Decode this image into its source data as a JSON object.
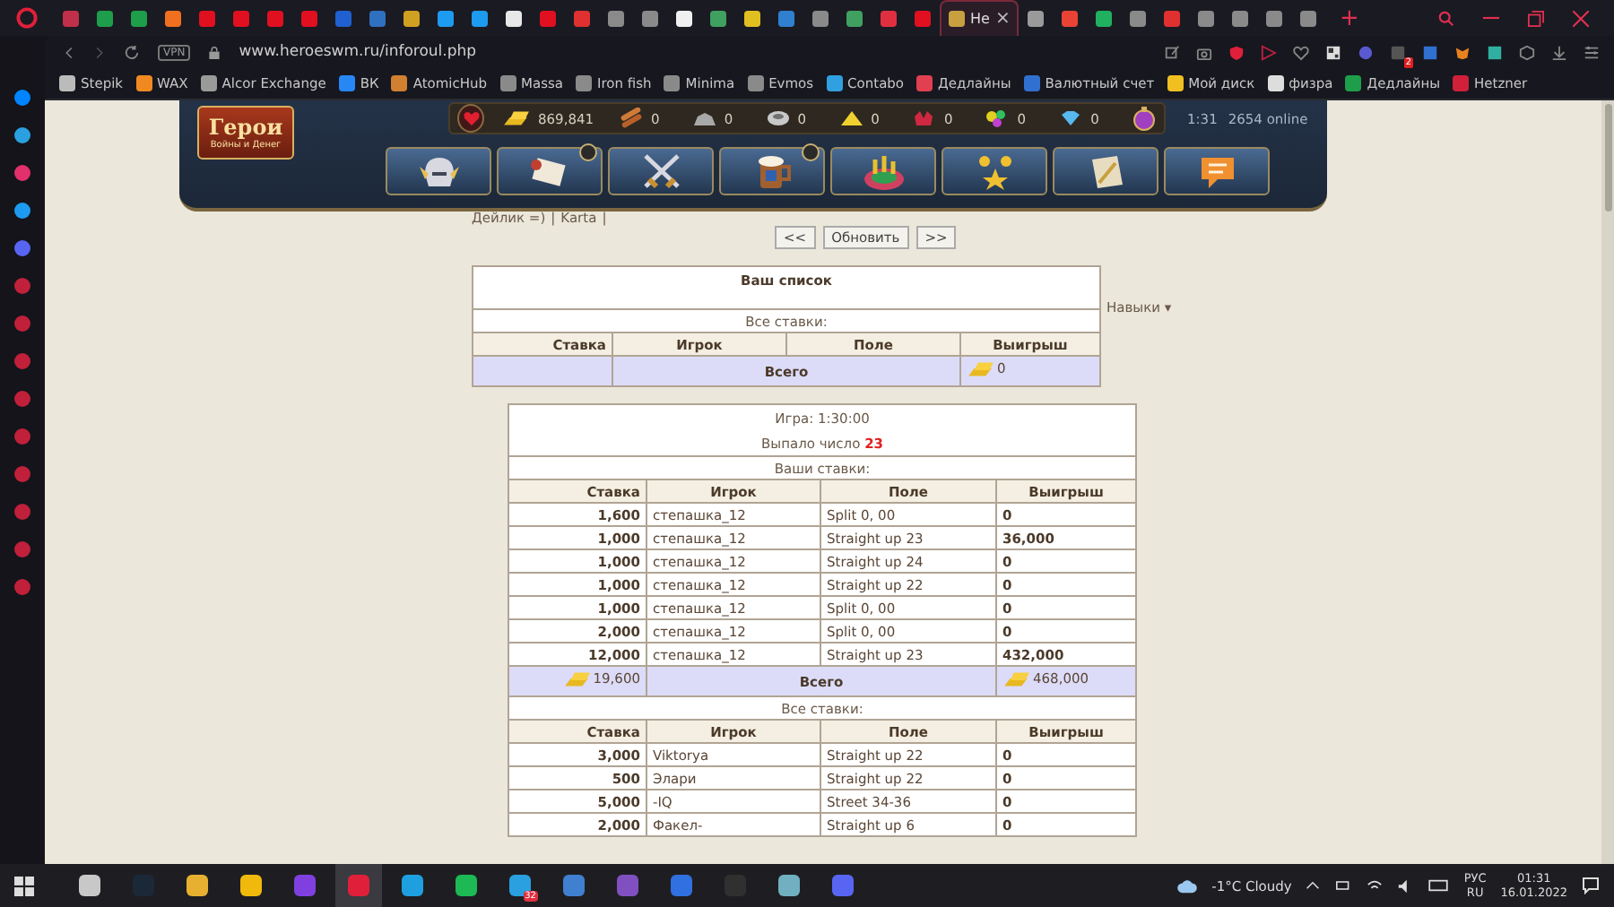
{
  "browser": {
    "tabs": [
      {
        "color": "#c0304a",
        "selected": false
      },
      {
        "color": "#1e9e4a",
        "selected": false
      },
      {
        "color": "#1e9e4a",
        "selected": false
      },
      {
        "color": "#f07020",
        "selected": false
      },
      {
        "color": "#e01020",
        "selected": false
      },
      {
        "color": "#e01020",
        "selected": false
      },
      {
        "color": "#e01020",
        "selected": false
      },
      {
        "color": "#e01020",
        "selected": false
      },
      {
        "color": "#2060d0",
        "selected": false
      },
      {
        "color": "#3070c0",
        "selected": false
      },
      {
        "color": "#d0a020",
        "selected": false
      },
      {
        "color": "#1d9bf0",
        "selected": false
      },
      {
        "color": "#1d9bf0",
        "selected": false
      },
      {
        "color": "#e8e8e8",
        "selected": false
      },
      {
        "color": "#e01020",
        "selected": false
      },
      {
        "color": "#e03030",
        "selected": false
      },
      {
        "color": "#8a8a8a",
        "selected": false
      },
      {
        "color": "#8a8a8a",
        "selected": false
      },
      {
        "color": "#f0f0f0",
        "selected": false
      },
      {
        "color": "#40a060",
        "selected": false
      },
      {
        "color": "#e0c020",
        "selected": false
      },
      {
        "color": "#3080d0",
        "selected": false
      },
      {
        "color": "#8a8a8a",
        "selected": false
      },
      {
        "color": "#40a060",
        "selected": false
      },
      {
        "color": "#e03040",
        "selected": false
      },
      {
        "color": "#e01020",
        "selected": false
      },
      {
        "color": "#c8a040",
        "selected": true,
        "title": "Не",
        "close": "×"
      },
      {
        "color": "#9a9a9a",
        "selected": false
      },
      {
        "color": "#ea4335",
        "selected": false
      },
      {
        "color": "#20b060",
        "selected": false
      },
      {
        "color": "#8a8a8a",
        "selected": false
      },
      {
        "color": "#e03030",
        "selected": false
      },
      {
        "color": "#8a8a8a",
        "selected": false
      },
      {
        "color": "#8a8a8a",
        "selected": false
      },
      {
        "color": "#8a8a8a",
        "selected": false
      },
      {
        "color": "#8a8a8a",
        "selected": false
      }
    ],
    "new_tab": "+",
    "vpn": "VPN",
    "url": "www.heroeswm.ru/inforoul.php",
    "extension_badge": "2",
    "bookmarks": [
      {
        "label": "Stepik",
        "color": "#bbbbbb"
      },
      {
        "label": "WAX",
        "color": "#f08a20"
      },
      {
        "label": "Alcor Exchange",
        "color": "#9a9a9a"
      },
      {
        "label": "ВК",
        "color": "#2787f5"
      },
      {
        "label": "AtomicHub",
        "color": "#d08030"
      },
      {
        "label": "Massa",
        "color": "#8a8a8a"
      },
      {
        "label": "Iron fish",
        "color": "#8a8a8a"
      },
      {
        "label": "Minima",
        "color": "#8a8a8a"
      },
      {
        "label": "Evmos",
        "color": "#8a8a8a"
      },
      {
        "label": "Contabo",
        "color": "#30a0e0"
      },
      {
        "label": "Дедлайны",
        "color": "#e04050"
      },
      {
        "label": "Валютный счет",
        "color": "#3070d0"
      },
      {
        "label": "Мой диск",
        "color": "#f0c020"
      },
      {
        "label": "физра",
        "color": "#dddddd"
      },
      {
        "label": "Дедлайны",
        "color": "#1e9e4a"
      },
      {
        "label": "Hetzner",
        "color": "#d0203a"
      }
    ]
  },
  "game": {
    "logo_title": "Герои",
    "logo_subtitle": "Войны и Денег",
    "resources": [
      {
        "kind": "gold",
        "amount": "869,841"
      },
      {
        "kind": "wood",
        "amount": "0"
      },
      {
        "kind": "ore",
        "amount": "0"
      },
      {
        "kind": "mercury",
        "amount": "0"
      },
      {
        "kind": "sulfur",
        "amount": "0"
      },
      {
        "kind": "crystals",
        "amount": "0"
      },
      {
        "kind": "gems",
        "amount": "0"
      },
      {
        "kind": "diamonds",
        "amount": "0"
      }
    ],
    "time": "1:31",
    "online": "2654 online",
    "nav": [
      {
        "kind": "helmet",
        "marked": false
      },
      {
        "kind": "scroll",
        "marked": true
      },
      {
        "kind": "swords",
        "marked": false
      },
      {
        "kind": "mug",
        "marked": true
      },
      {
        "kind": "roulette",
        "marked": false
      },
      {
        "kind": "stars",
        "marked": false
      },
      {
        "kind": "map",
        "marked": false
      },
      {
        "kind": "chat",
        "marked": false
      }
    ]
  },
  "links": [
    {
      "label": "Дейлик =)",
      "separator": "|"
    },
    {
      "label": "Karta",
      "separator": "|"
    }
  ],
  "pager": {
    "prev": "<<",
    "refresh": "Обновить",
    "next": ">>"
  },
  "skills_menu": "Навыки ▾",
  "my_list": {
    "title": "Ваш список",
    "subtitle": "Все ставки:",
    "columns": [
      "Ставка",
      "Игрок",
      "Поле",
      "Выигрыш"
    ],
    "total_label": "Всего",
    "total_win": "0"
  },
  "game_result": {
    "game": "Игра: 1:30:00",
    "result_label": "Выпало число",
    "result_number": "23",
    "my_bets_title": "Ваши ставки:",
    "columns": [
      "Ставка",
      "Игрок",
      "Поле",
      "Выигрыш"
    ],
    "my_bets": [
      {
        "stake": "1,600",
        "player": "степашка_12",
        "field": "Split 0, 00",
        "win": "0"
      },
      {
        "stake": "1,000",
        "player": "степашка_12",
        "field": "Straight up 23",
        "win": "36,000"
      },
      {
        "stake": "1,000",
        "player": "степашка_12",
        "field": "Straight up 24",
        "win": "0"
      },
      {
        "stake": "1,000",
        "player": "степашка_12",
        "field": "Straight up 22",
        "win": "0"
      },
      {
        "stake": "1,000",
        "player": "степашка_12",
        "field": "Split 0, 00",
        "win": "0"
      },
      {
        "stake": "2,000",
        "player": "степашка_12",
        "field": "Split 0, 00",
        "win": "0"
      },
      {
        "stake": "12,000",
        "player": "степашка_12",
        "field": "Straight up 23",
        "win": "432,000"
      }
    ],
    "total_stake": "19,600",
    "total_label": "Всего",
    "total_win": "468,000",
    "all_bets_title": "Все ставки:",
    "all_columns": [
      "Ставка",
      "Игрок",
      "Поле",
      "Выигрыш"
    ],
    "all_bets": [
      {
        "stake": "3,000",
        "player": "Viktorya",
        "field": "Straight up 22",
        "win": "0"
      },
      {
        "stake": "500",
        "player": "Элари",
        "field": "Straight up 22",
        "win": "0"
      },
      {
        "stake": "5,000",
        "player": "-IQ",
        "field": "Street 34-36",
        "win": "0"
      },
      {
        "stake": "2,000",
        "player": "Факел-",
        "field": "Straight up 6",
        "win": "0"
      }
    ]
  },
  "taskbar": {
    "apps": [
      {
        "color": "#c8c8c8",
        "selected": false
      },
      {
        "color": "#1b2838",
        "selected": false
      },
      {
        "color": "#e8b030",
        "selected": false
      },
      {
        "color": "#f0b90b",
        "selected": false
      },
      {
        "color": "#8040e0",
        "selected": false
      },
      {
        "color": "#e0203a",
        "selected": true
      },
      {
        "color": "#1ea0e0",
        "selected": false
      },
      {
        "color": "#1db954",
        "selected": false
      },
      {
        "color": "#2aa0e0",
        "selected": false,
        "badge": "32"
      },
      {
        "color": "#4080d0",
        "selected": false
      },
      {
        "color": "#8050c0",
        "selected": false
      },
      {
        "color": "#3070e0",
        "selected": false
      },
      {
        "color": "#303030",
        "selected": false
      },
      {
        "color": "#70b0c0",
        "selected": false
      },
      {
        "color": "#5865f2",
        "selected": false
      }
    ],
    "weather": "-1°C Cloudy",
    "lang": "РУС",
    "lang_code": "RU",
    "time": "01:31",
    "date": "16.01.2022"
  }
}
